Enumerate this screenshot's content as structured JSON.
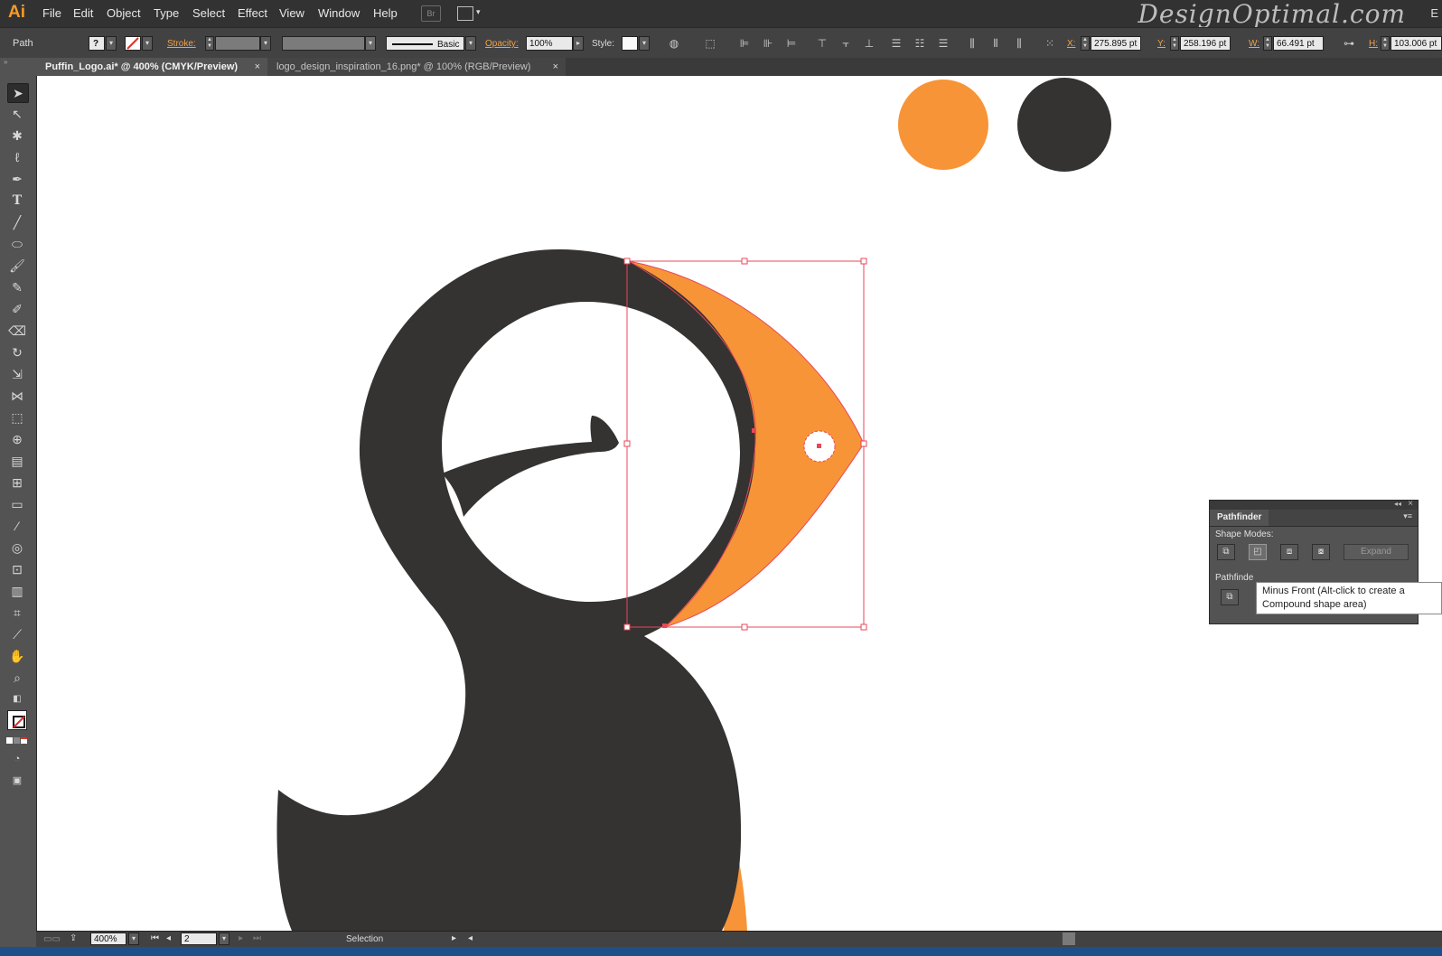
{
  "menubar": {
    "app_logo": "Ai",
    "items": [
      "File",
      "Edit",
      "Object",
      "Type",
      "Select",
      "Effect",
      "View",
      "Window",
      "Help"
    ],
    "bridge": "Br",
    "watermark": "DesignOptimal.com",
    "far_right": "E"
  },
  "control_bar": {
    "object_type": "Path",
    "fill_swatch": "?",
    "stroke_label": "Stroke:",
    "brush_label": "Basic",
    "opacity_label": "Opacity:",
    "opacity_value": "100%",
    "style_label": "Style:",
    "x_label": "X:",
    "x_value": "275.895 pt",
    "y_label": "Y:",
    "y_value": "258.196 pt",
    "w_label": "W:",
    "w_value": "66.491 pt",
    "h_label": "H:",
    "h_value": "103.006 pt"
  },
  "tabs": [
    {
      "label": "Puffin_Logo.ai* @ 400% (CMYK/Preview)",
      "close": "×"
    },
    {
      "label": "logo_design_inspiration_16.png* @ 100% (RGB/Preview)",
      "close": "×"
    }
  ],
  "pathfinder": {
    "title": "Pathfinder",
    "shape_modes_label": "Shape Modes:",
    "expand_label": "Expand",
    "pathfinders_label": "Pathfinde",
    "tooltip": "Minus Front (Alt-click to create a Compound shape area)",
    "collapse_icon": "◂◂",
    "close_icon": "×",
    "menu_icon": "▾≡"
  },
  "status_bar": {
    "zoom": "400%",
    "artboard": "2",
    "tool": "Selection"
  },
  "colors": {
    "orange": "#f79437",
    "dark": "#343332",
    "selection": "#e8475a"
  }
}
